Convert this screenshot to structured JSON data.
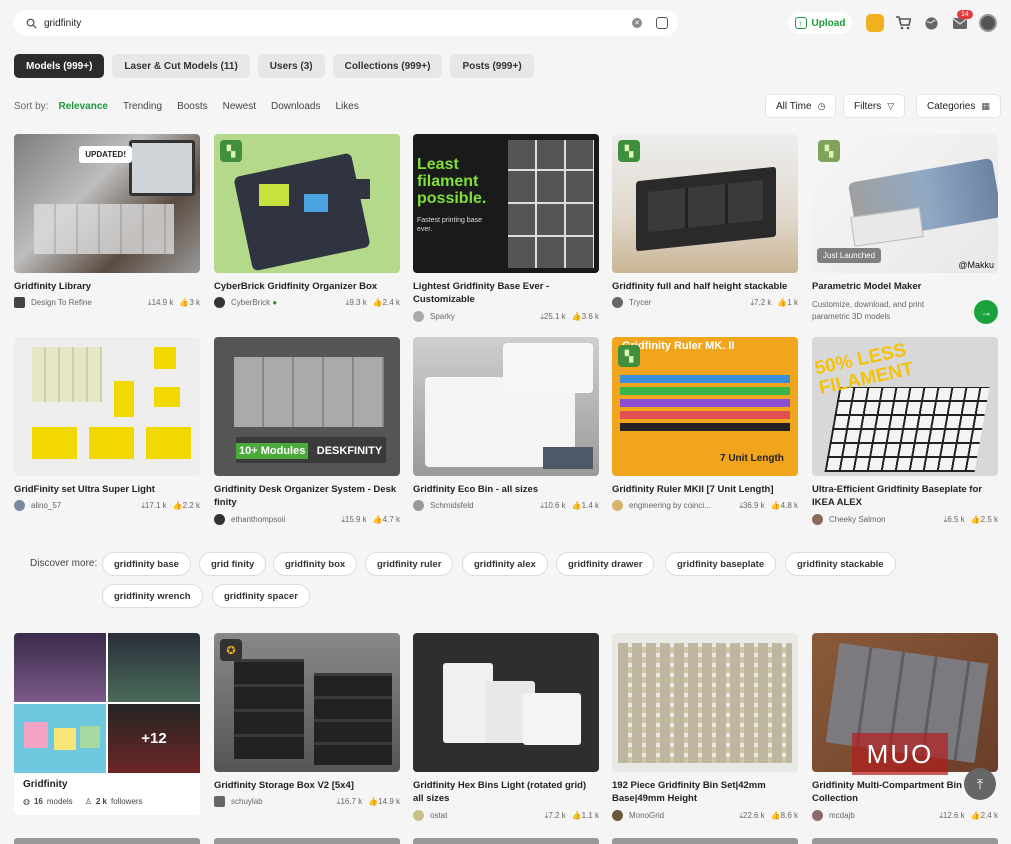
{
  "search": {
    "value": "gridfinity",
    "placeholder": "Search"
  },
  "header": {
    "upload_label": "Upload",
    "notifications_count": "14"
  },
  "tabs": [
    {
      "label": "Models (999+)"
    },
    {
      "label": "Laser & Cut Models (11)"
    },
    {
      "label": "Users (3)"
    },
    {
      "label": "Collections (999+)"
    },
    {
      "label": "Posts (999+)"
    }
  ],
  "sort": {
    "label": "Sort by:",
    "options": [
      "Relevance",
      "Trending",
      "Boosts",
      "Newest",
      "Downloads",
      "Likes"
    ],
    "time_label": "All Time",
    "filters_label": "Filters",
    "categories_label": "Categories"
  },
  "cards_row1": [
    {
      "title": "Gridfinity Library",
      "author": "Design To Refine",
      "downloads": "14.9 k",
      "likes": "3 k",
      "badge": "UPDATED!"
    },
    {
      "title": "CyberBrick Gridfinity Organizer Box",
      "author": "CyberBrick",
      "downloads": "9.3 k",
      "likes": "2.4 k"
    },
    {
      "title": "Lightest Gridfinity Base Ever - Customizable",
      "author": "Sparky",
      "downloads": "25.1 k",
      "likes": "3.6 k",
      "thumb_text": "Least filament possible.",
      "thumb_sub": "Fastest printing base ever."
    },
    {
      "title": "Gridfinity full and half height stackable",
      "author": "Trycer",
      "downloads": "7.2 k",
      "likes": "1 k"
    },
    {
      "title": "Parametric Model Maker",
      "subtitle": "Customize, download, and print parametric 3D models",
      "launch_tag": "Just Launched",
      "handle": "@Makku"
    }
  ],
  "cards_row2": [
    {
      "title": "GridFinity set Ultra Super Light",
      "author": "alino_57",
      "downloads": "17.1 k",
      "likes": "2.2 k"
    },
    {
      "title": "Gridfinity Desk Organizer System - Desk finity",
      "author": "ethanthompsoii",
      "downloads": "15.9 k",
      "likes": "4.7 k",
      "thumb_text": "10+ Modules",
      "thumb_text2": "DESKFINITY"
    },
    {
      "title": "Gridfinity Eco Bin - all sizes",
      "author": "Schmidsfeld",
      "downloads": "10.6 k",
      "likes": "1.4 k"
    },
    {
      "title": "Gridfinity Ruler MKII [7 Unit Length]",
      "author": "engineering by coinci...",
      "downloads": "36.9 k",
      "likes": "4.8 k",
      "thumb_text": "Gridfinity Ruler MK. II",
      "thumb_sub": "7 Unit Length"
    },
    {
      "title": "Ultra-Efficient Gridfinity Baseplate for IKEA ALEX",
      "author": "Cheeky Salmon",
      "downloads": "6.5 k",
      "likes": "2.5 k",
      "thumb_text": "50% LESS FILAMENT"
    }
  ],
  "discover": {
    "label": "Discover more:",
    "chips": [
      "gridfinity base",
      "grid finity",
      "gridfinity box",
      "gridfinity ruler",
      "gridfinity alex",
      "gridfinity drawer",
      "gridfinity baseplate",
      "gridfinity stackable",
      "gridfinity wrench",
      "gridfinity spacer"
    ]
  },
  "collection": {
    "title": "Gridfinity",
    "models": "16",
    "models_label": "models",
    "followers": "2 k",
    "followers_label": "followers",
    "more": "+12"
  },
  "cards_row3": [
    {
      "title": "Gridfinity Storage Box V2 [5x4]",
      "author": "schuylab",
      "downloads": "16.7 k",
      "likes": "14.9 k"
    },
    {
      "title": "Gridfinity Hex Bins Light (rotated grid) all sizes",
      "author": "ostat",
      "downloads": "7.2 k",
      "likes": "1.1 k"
    },
    {
      "title": "192 Piece Gridfinity Bin Set|42mm Base|49mm Height",
      "author": "MonoGrid",
      "downloads": "22.6 k",
      "likes": "8.6 k"
    },
    {
      "title": "Gridfinity Multi-Compartment Bin Collection",
      "author": "mcdajb",
      "downloads": "12.6 k",
      "likes": "2.4 k"
    }
  ],
  "watermark": "MUO"
}
